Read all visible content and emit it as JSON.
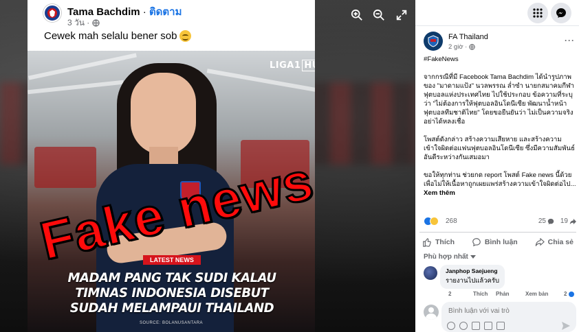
{
  "card": {
    "author": "Tama Bachdim",
    "separator": " · ",
    "follow": "ติดตาม",
    "time": "3 วัน ·",
    "caption": "Cewek mah selalu bener sob"
  },
  "image": {
    "logo_main": "LIGA1",
    "logo_box": "HUB",
    "tag": "LATEST NEWS",
    "headline": [
      "MADAM PANG TAK SUDI KALAU",
      "TIMNAS INDONESIA DISEBUT",
      "SUDAH MELAMPAUI THAILAND"
    ],
    "source": "SOURCE: BOLANUSANTARA",
    "stamp": "Fake news"
  },
  "viewer": {
    "icons": [
      "zoom-in-icon",
      "zoom-out-icon",
      "fullscreen-icon"
    ]
  },
  "page": {
    "name": "FA Thailand",
    "time": "2 giờ ·",
    "more": "···"
  },
  "post": {
    "hashtag": "#FakeNews",
    "paragraph1": "จากกรณีที่มี Facebook Tama Bachdim ได้นำรูปภาพของ \"มาดามแป้ง\" นวลพรรณ ล่ำซำ นายกสมาคมกีฬาฟุตบอลแห่งประเทศไทย ไปใช้ประกอบ ข้อความที่ระบุว่า \"ไม่ต้องการให้ฟุตบอลอินโดนีเซีย พัฒนาน้ำหน้าฟุตบอลทีมชาติไทย\" โดยขอยืนยันว่า ไม่เป็นความจริง อย่าได้หลงเชื่อ",
    "paragraph2": "โพสต์ดังกล่าว สร้างความเสียหาย และสร้างความเข้าใจผิดต่อแฟนฟุตบอลอินโดนีเซีย ซึ่งมีความสัมพันธ์อันดีระหว่างกันเสมอมา",
    "paragraph3": "ขอให้ทุกท่าน ช่วยกด report โพสต์ Fake news นี้ด้วย เพื่อไม่ให้เนื้อหาถูกเผยแพร่สร้างความเข้าใจผิดต่อไป...",
    "see_more": "Xem thêm"
  },
  "stats": {
    "reactions": "268",
    "comments": "25",
    "shares": "19"
  },
  "actions": {
    "like": "Thích",
    "comment": "Bình luận",
    "share": "Chia sẻ"
  },
  "sort": "Phù hợp nhất",
  "comment": {
    "author": "Janphop Saejueng",
    "text": "รายงานไปแล้วครับ",
    "time": "2",
    "like": "Thích",
    "reply": "Phản",
    "translate": "Xem bản",
    "reaction_count": "2"
  },
  "composer": {
    "placeholder": "Bình luận với vai trò"
  },
  "colors": {
    "facebook_blue": "#1b74e4",
    "stamp_red": "#ff0b0b",
    "viewer_bg": "#18191a"
  }
}
